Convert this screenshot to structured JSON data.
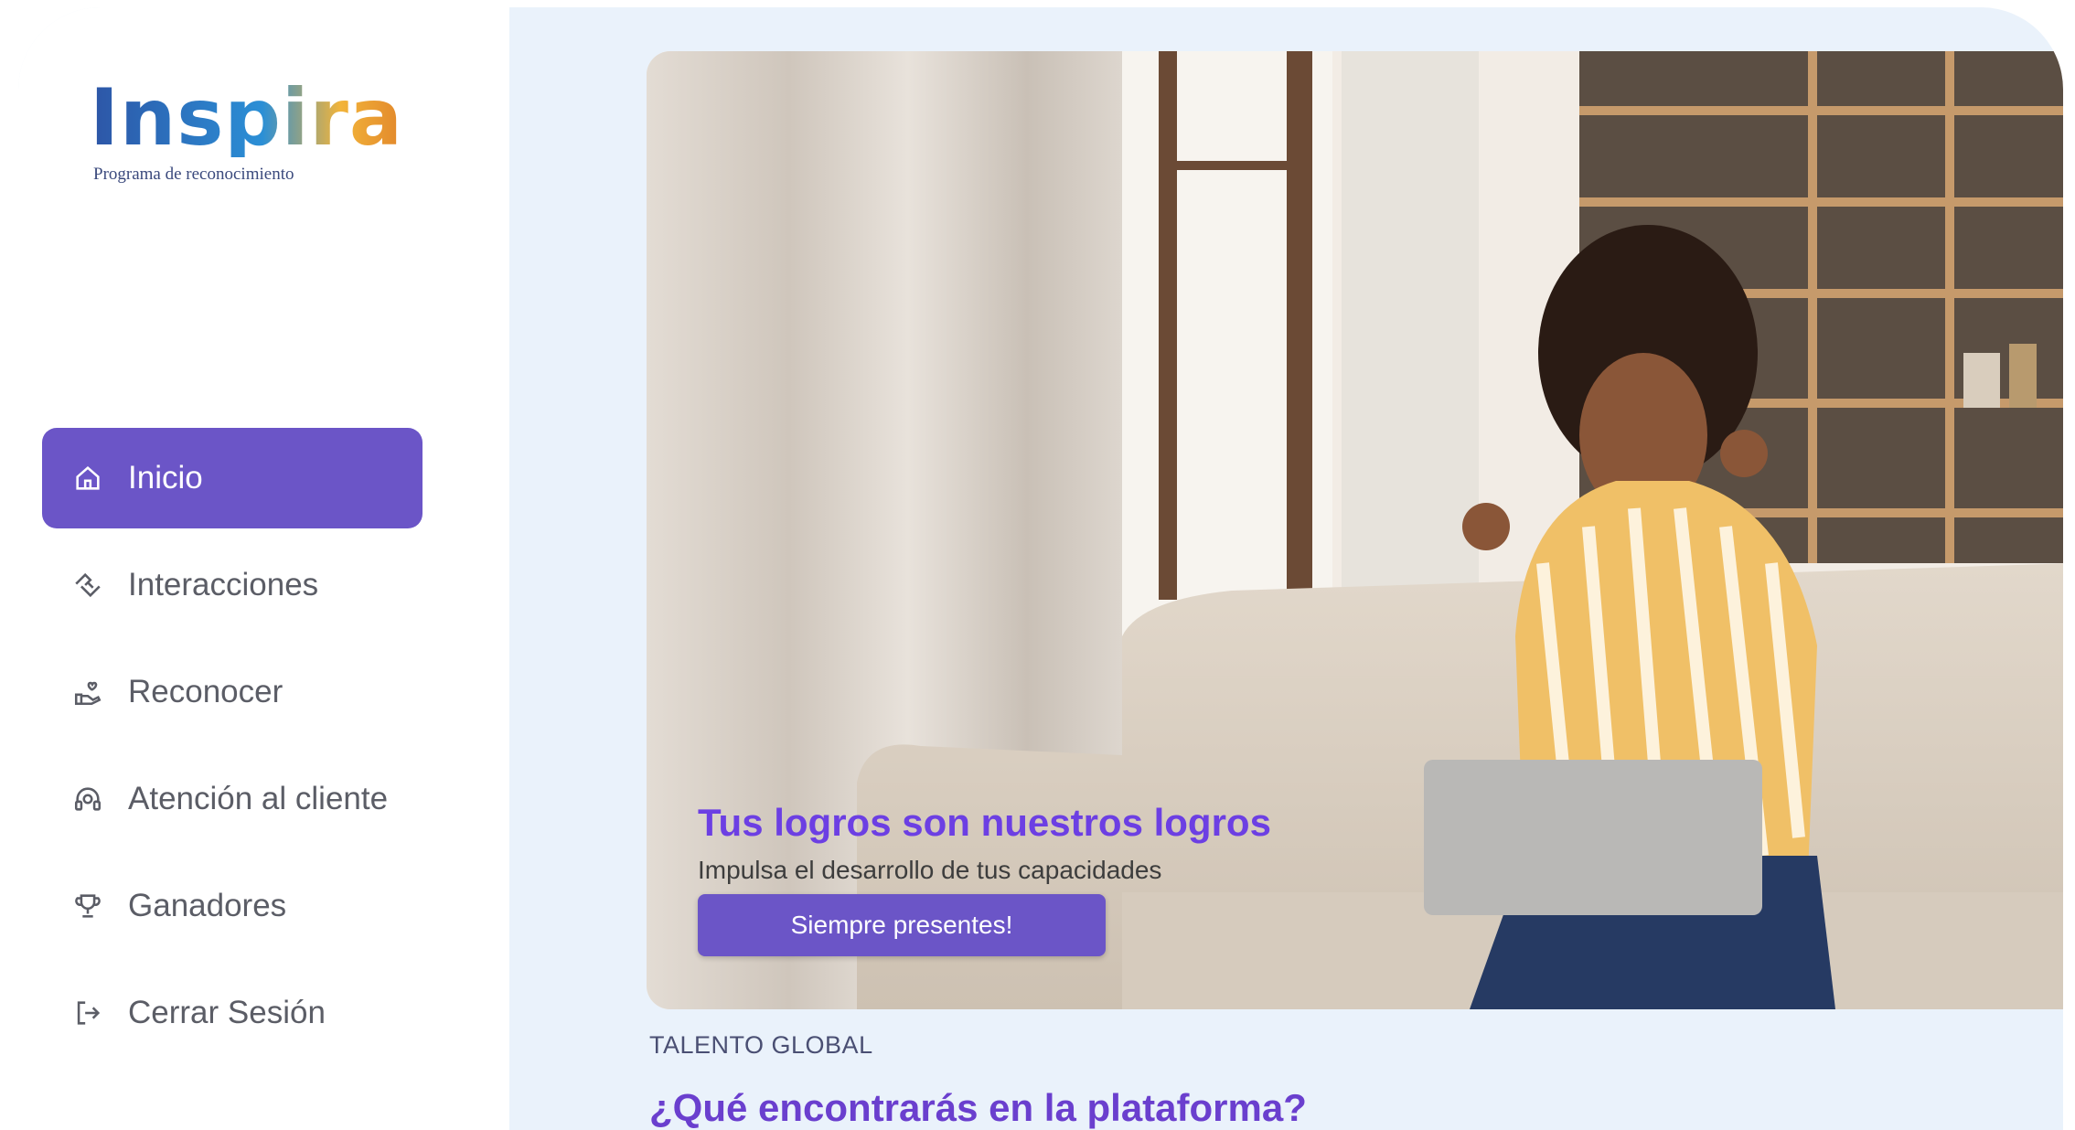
{
  "brand": {
    "name": "Inspira",
    "tagline": "Programa de reconocimiento",
    "colors": {
      "primary": "#6b55c7",
      "heading": "#6c3fe3",
      "background": "#eaf2fb"
    }
  },
  "sidebar": {
    "items": [
      {
        "label": "Inicio",
        "icon": "home-icon",
        "active": true
      },
      {
        "label": "Interacciones",
        "icon": "handshake-icon",
        "active": false
      },
      {
        "label": "Reconocer",
        "icon": "hand-heart-icon",
        "active": false
      },
      {
        "label": "Atención al cliente",
        "icon": "headset-icon",
        "active": false
      },
      {
        "label": "Ganadores",
        "icon": "trophy-icon",
        "active": false
      },
      {
        "label": "Cerrar Sesión",
        "icon": "logout-icon",
        "active": false
      }
    ]
  },
  "hero": {
    "title": "Tus logros son nuestros logros",
    "subtitle": "Impulsa el desarrollo de tus capacidades",
    "cta_label": "Siempre presentes!"
  },
  "content": {
    "eyebrow": "TALENTO GLOBAL",
    "section_title": "¿Qué encontrarás en la plataforma?"
  }
}
